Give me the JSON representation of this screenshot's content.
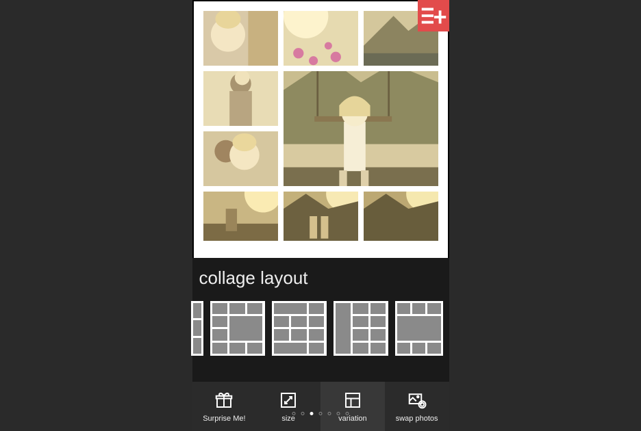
{
  "section_title": "collage layout",
  "appbar": {
    "surprise_label": "Surprise Me!",
    "size_label": "size",
    "variation_label": "variation",
    "swap_label": "swap photos"
  },
  "pager": {
    "count": 7,
    "active_index": 2
  },
  "colors": {
    "accent": "#e24b4b"
  }
}
